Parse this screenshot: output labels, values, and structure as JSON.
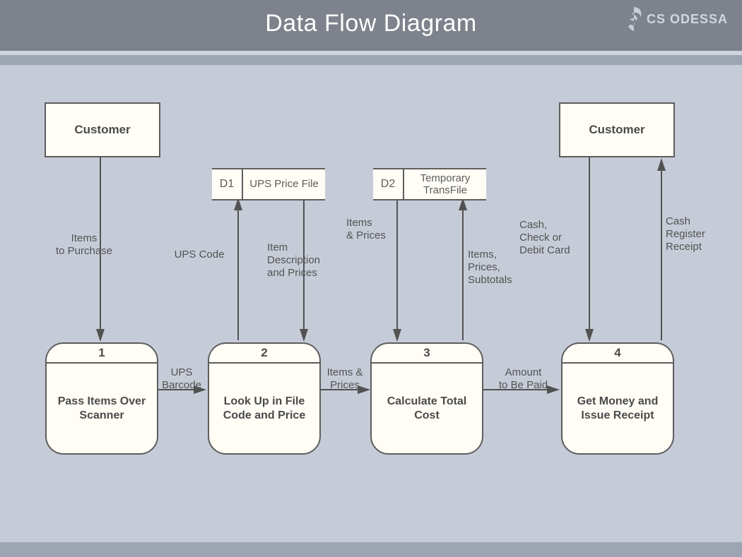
{
  "header": {
    "title": "Data Flow Diagram",
    "brand": "CS ODESSA"
  },
  "entities": {
    "customer_left": "Customer",
    "customer_right": "Customer"
  },
  "datastores": {
    "d1": {
      "id": "D1",
      "label": "UPS Price File"
    },
    "d2": {
      "id": "D2",
      "label": "Temporary TransFile"
    }
  },
  "processes": {
    "p1": {
      "num": "1",
      "label": "Pass Items Over Scanner"
    },
    "p2": {
      "num": "2",
      "label": "Look Up in File Code and Price"
    },
    "p3": {
      "num": "3",
      "label": "Calculate Total Cost"
    },
    "p4": {
      "num": "4",
      "label": "Get Money and Issue Receipt"
    }
  },
  "flows": {
    "items_to_purchase": "Items\nto Purchase",
    "ups_code": "UPS Code",
    "item_desc": "Item\nDescription\nand Prices",
    "items_prices_down": "Items\n& Prices",
    "items_prices_subtotals": "Items,\nPrices,\nSubtotals",
    "cash_check": "Cash,\nCheck or\nDebit Card",
    "cash_receipt": "Cash\nRegister\nReceipt",
    "ups_barcode": "UPS\nBarcode",
    "items_prices_right": "Items &\nPrices",
    "amount_paid": "Amount\nto Be Paid"
  }
}
